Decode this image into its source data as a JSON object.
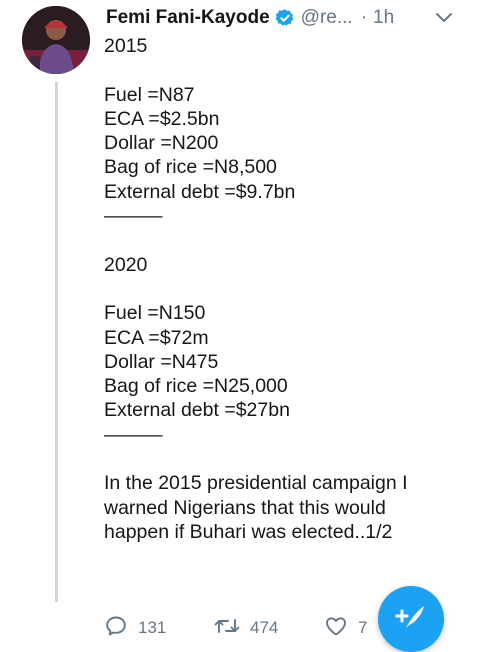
{
  "tweet": {
    "author_name": "Femi Fani-Kayode",
    "handle": "@re...",
    "separator": "·",
    "time": "1h",
    "text": "2015\n\nFuel =N87\nECA =$2.5bn\nDollar =N200\nBag of rice =N8,500\nExternal debt =$9.7bn\n———\n\n2020\n\nFuel =N150\nECA =$72m\nDollar =N475\nBag of rice =N25,000\nExternal debt =$27bn\n———\n\nIn the 2015 presidential campaign I warned Nigerians that this would happen if Buhari was elected..1/2"
  },
  "actions": {
    "replies": "131",
    "retweets": "474",
    "likes": "7"
  },
  "icons": {
    "verified": "verified-badge-icon",
    "chevron": "chevron-down-icon",
    "reply": "reply-icon",
    "retweet": "retweet-icon",
    "like": "like-icon",
    "compose": "compose-tweet-icon"
  },
  "colors": {
    "brand_blue": "#1da1f2",
    "secondary_text": "#657786",
    "primary_text": "#14171a"
  }
}
